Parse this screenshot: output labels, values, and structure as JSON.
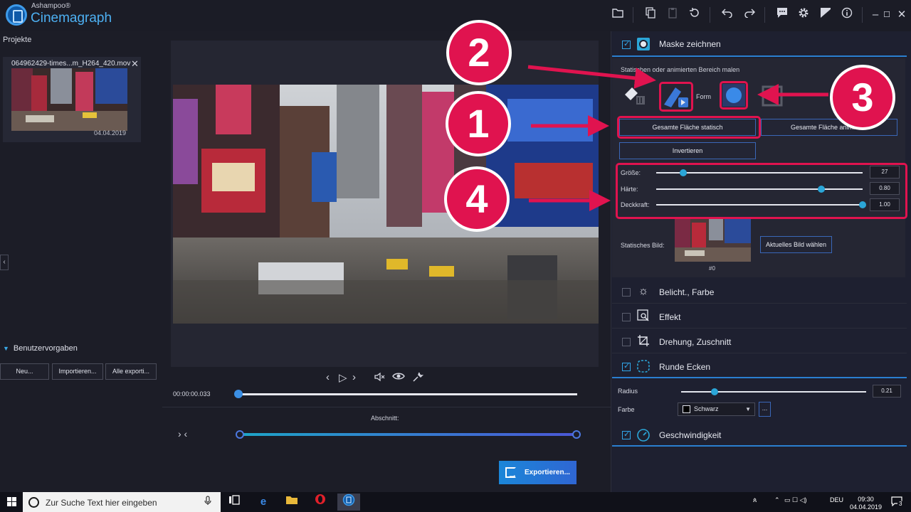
{
  "app": {
    "brand": "Ashampoo®",
    "name": "Cinemagraph"
  },
  "titlebar": {
    "icons": [
      "folder-icon",
      "copy-icon",
      "paste-icon",
      "reset-icon",
      "undo-icon",
      "redo-icon",
      "feedback-icon",
      "gear-icon",
      "image-icon",
      "info-icon",
      "minimize-icon",
      "maximize-icon",
      "close-icon"
    ]
  },
  "left": {
    "projects_label": "Projekte",
    "project": {
      "name": "064962429-times...m_H264_420.mov",
      "date": "04.04.2019"
    },
    "presets_label": "Benutzervorgaben",
    "preset_buttons": {
      "new": "Neu...",
      "import": "Importieren...",
      "export_all": "Alle exporti..."
    }
  },
  "player": {
    "timecode": "00:00:00.033",
    "progress": 0.0,
    "section_label": "Abschnitt:",
    "export_label": "Exportieren..."
  },
  "right": {
    "mask": {
      "title": "Maske zeichnen",
      "enabled": true,
      "hint": "Statischen oder animierten Bereich malen",
      "form_label": "Form",
      "static_all": "Gesamte Fläche statisch",
      "animate_all": "Gesamte Fläche animieren",
      "invert": "Invertieren",
      "size_label": "Größe:",
      "size_value": "27",
      "size_pos": 0.13,
      "hardness_label": "Härte:",
      "hardness_value": "0.80",
      "hardness_pos": 0.8,
      "opacity_label": "Deckkraft:",
      "opacity_value": "1.00",
      "opacity_pos": 1.0,
      "static_image_label": "Statisches Bild:",
      "frame_number": "#0",
      "current_image_btn": "Aktuelles Bild wählen"
    },
    "sections": {
      "exposure": "Belicht., Farbe",
      "effect": "Effekt",
      "rotation": "Drehung, Zuschnitt",
      "corners": "Runde Ecken",
      "speed": "Geschwindigkeit"
    },
    "corners": {
      "radius_label": "Radius",
      "radius_value": "0.21",
      "radius_pos": 0.18,
      "color_label": "Farbe",
      "color_value": "Schwarz",
      "more": "..."
    }
  },
  "annotations": [
    "1",
    "2",
    "3",
    "4"
  ],
  "colors": {
    "accent": "#2ba6d8",
    "annotation": "#e0134f"
  },
  "taskbar": {
    "search_placeholder": "Zur Suche Text hier eingeben",
    "lang": "DEU",
    "time": "09:30",
    "date": "04.04.2019",
    "notifications": "3"
  }
}
